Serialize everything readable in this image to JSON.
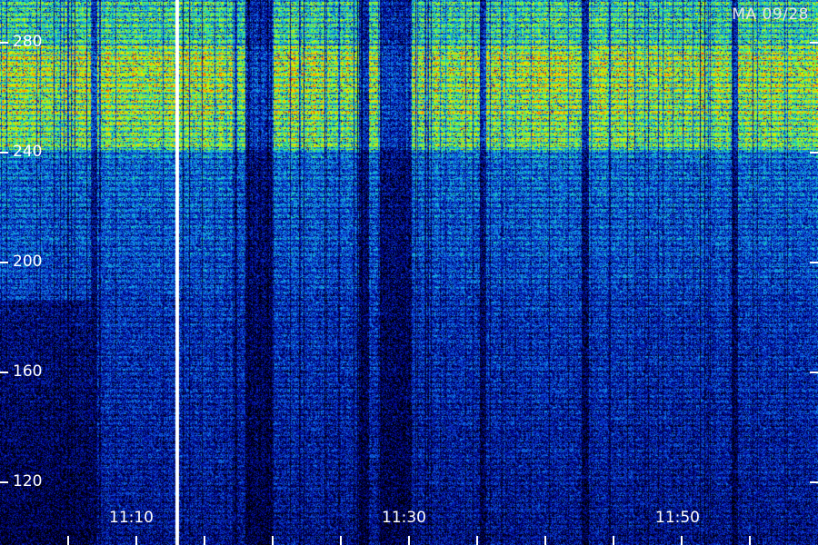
{
  "chart_data": {
    "type": "heatmap",
    "caption": "MA 09/28",
    "y_ticks": [
      120,
      160,
      200,
      240,
      280
    ],
    "x_tick_labels": [
      "11:10",
      "11:30",
      "11:50"
    ],
    "grid": false,
    "colormap": [
      "#000000",
      "#00008c",
      "#0a3cd2",
      "#12a0f0",
      "#20e6a0",
      "#b4ff00",
      "#ffd200",
      "#ff3c00"
    ],
    "bands": [
      {
        "freq_range": [
          240,
          290
        ],
        "intensity": "high"
      },
      {
        "freq_range": [
          180,
          240
        ],
        "intensity": "medium"
      },
      {
        "freq_range": [
          100,
          180
        ],
        "intensity": "low"
      }
    ]
  }
}
